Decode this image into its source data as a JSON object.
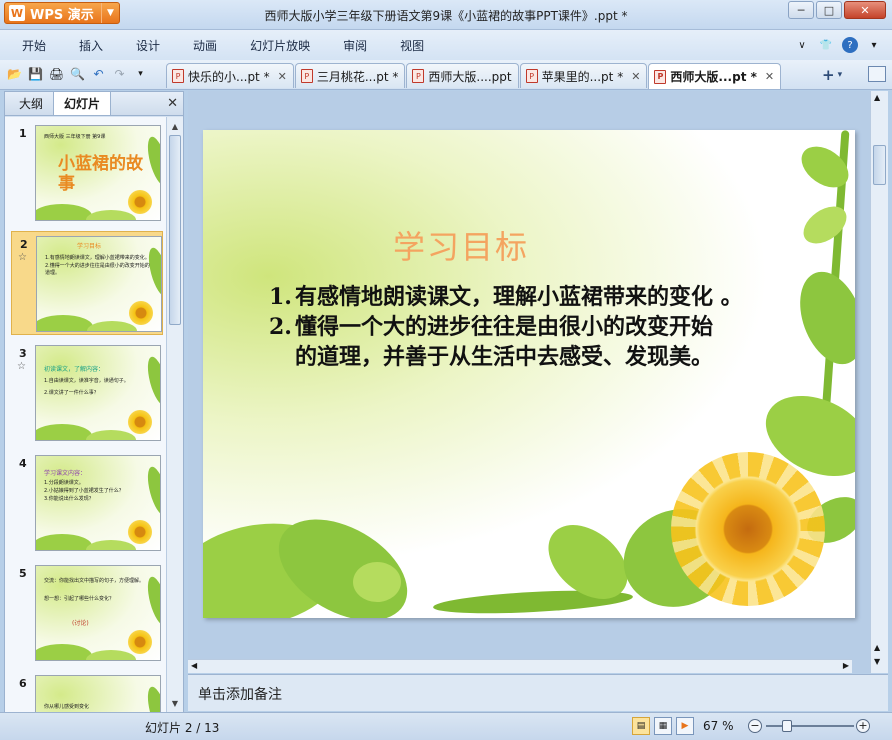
{
  "app": {
    "brand": "WPS 演示",
    "window_title": "西师大版小学三年级下册语文第9课《小蓝裙的故事PPT课件》.ppt *"
  },
  "menu": [
    "开始",
    "插入",
    "设计",
    "动画",
    "幻灯片放映",
    "审阅",
    "视图"
  ],
  "tabs": [
    {
      "label": "快乐的小...pt *",
      "active": false
    },
    {
      "label": "三月桃花...pt *",
      "active": false
    },
    {
      "label": "西师大版....ppt",
      "active": false
    },
    {
      "label": "苹果里的...pt *",
      "active": false
    },
    {
      "label": "西师大版...pt *",
      "active": true
    }
  ],
  "left_panel": {
    "tabs": [
      "大纲",
      "幻灯片"
    ],
    "active_tab": "幻灯片",
    "thumbnails": [
      {
        "num": "1",
        "lines": [
          "西师大版 三年级下册 第9课",
          "小蓝裙的故事"
        ]
      },
      {
        "num": "2",
        "lines": [
          "学习目标",
          "1.有感情地朗读课文，理解小蓝裙带来的变化。",
          "2.懂得一个大的进步往往是由很小的改变开始的道理。"
        ]
      },
      {
        "num": "3",
        "lines": [
          "初读课文，了解内容：",
          "1.自由读课文，读准字音，读通句子。",
          "2.课文讲了一件什么事？"
        ]
      },
      {
        "num": "4",
        "lines": [
          "学习课文内容：",
          "1.分段朗读课文。",
          "2.小姑娘得到了小蓝裙发生了什么？",
          "3.你能说出什么发现？"
        ]
      },
      {
        "num": "5",
        "lines": [
          "交流：你能找出文中描写的句子，方便理解。",
          "想一想：引起了哪些什么变化？",
          "(讨论)"
        ]
      },
      {
        "num": "6",
        "lines": [
          "你从哪儿感受到变化"
        ]
      }
    ]
  },
  "slide": {
    "title": "学习目标",
    "items": [
      {
        "num": "1.",
        "text": "有感情地朗读课文，理解小蓝裙带来的变化 。"
      },
      {
        "num": "2.",
        "text": "懂得一个大的进步往往是由很小的改变开始",
        "cont": "的道理，并善于从生活中去感受、发现美。"
      }
    ]
  },
  "notes_placeholder": "单击添加备注",
  "status": {
    "slide_info": "幻灯片 2 / 13",
    "zoom": "67 %"
  },
  "colors": {
    "title_orange": "#f4a460",
    "accent_orange": "#e8741b",
    "leaf_green": "#8dc63f"
  }
}
